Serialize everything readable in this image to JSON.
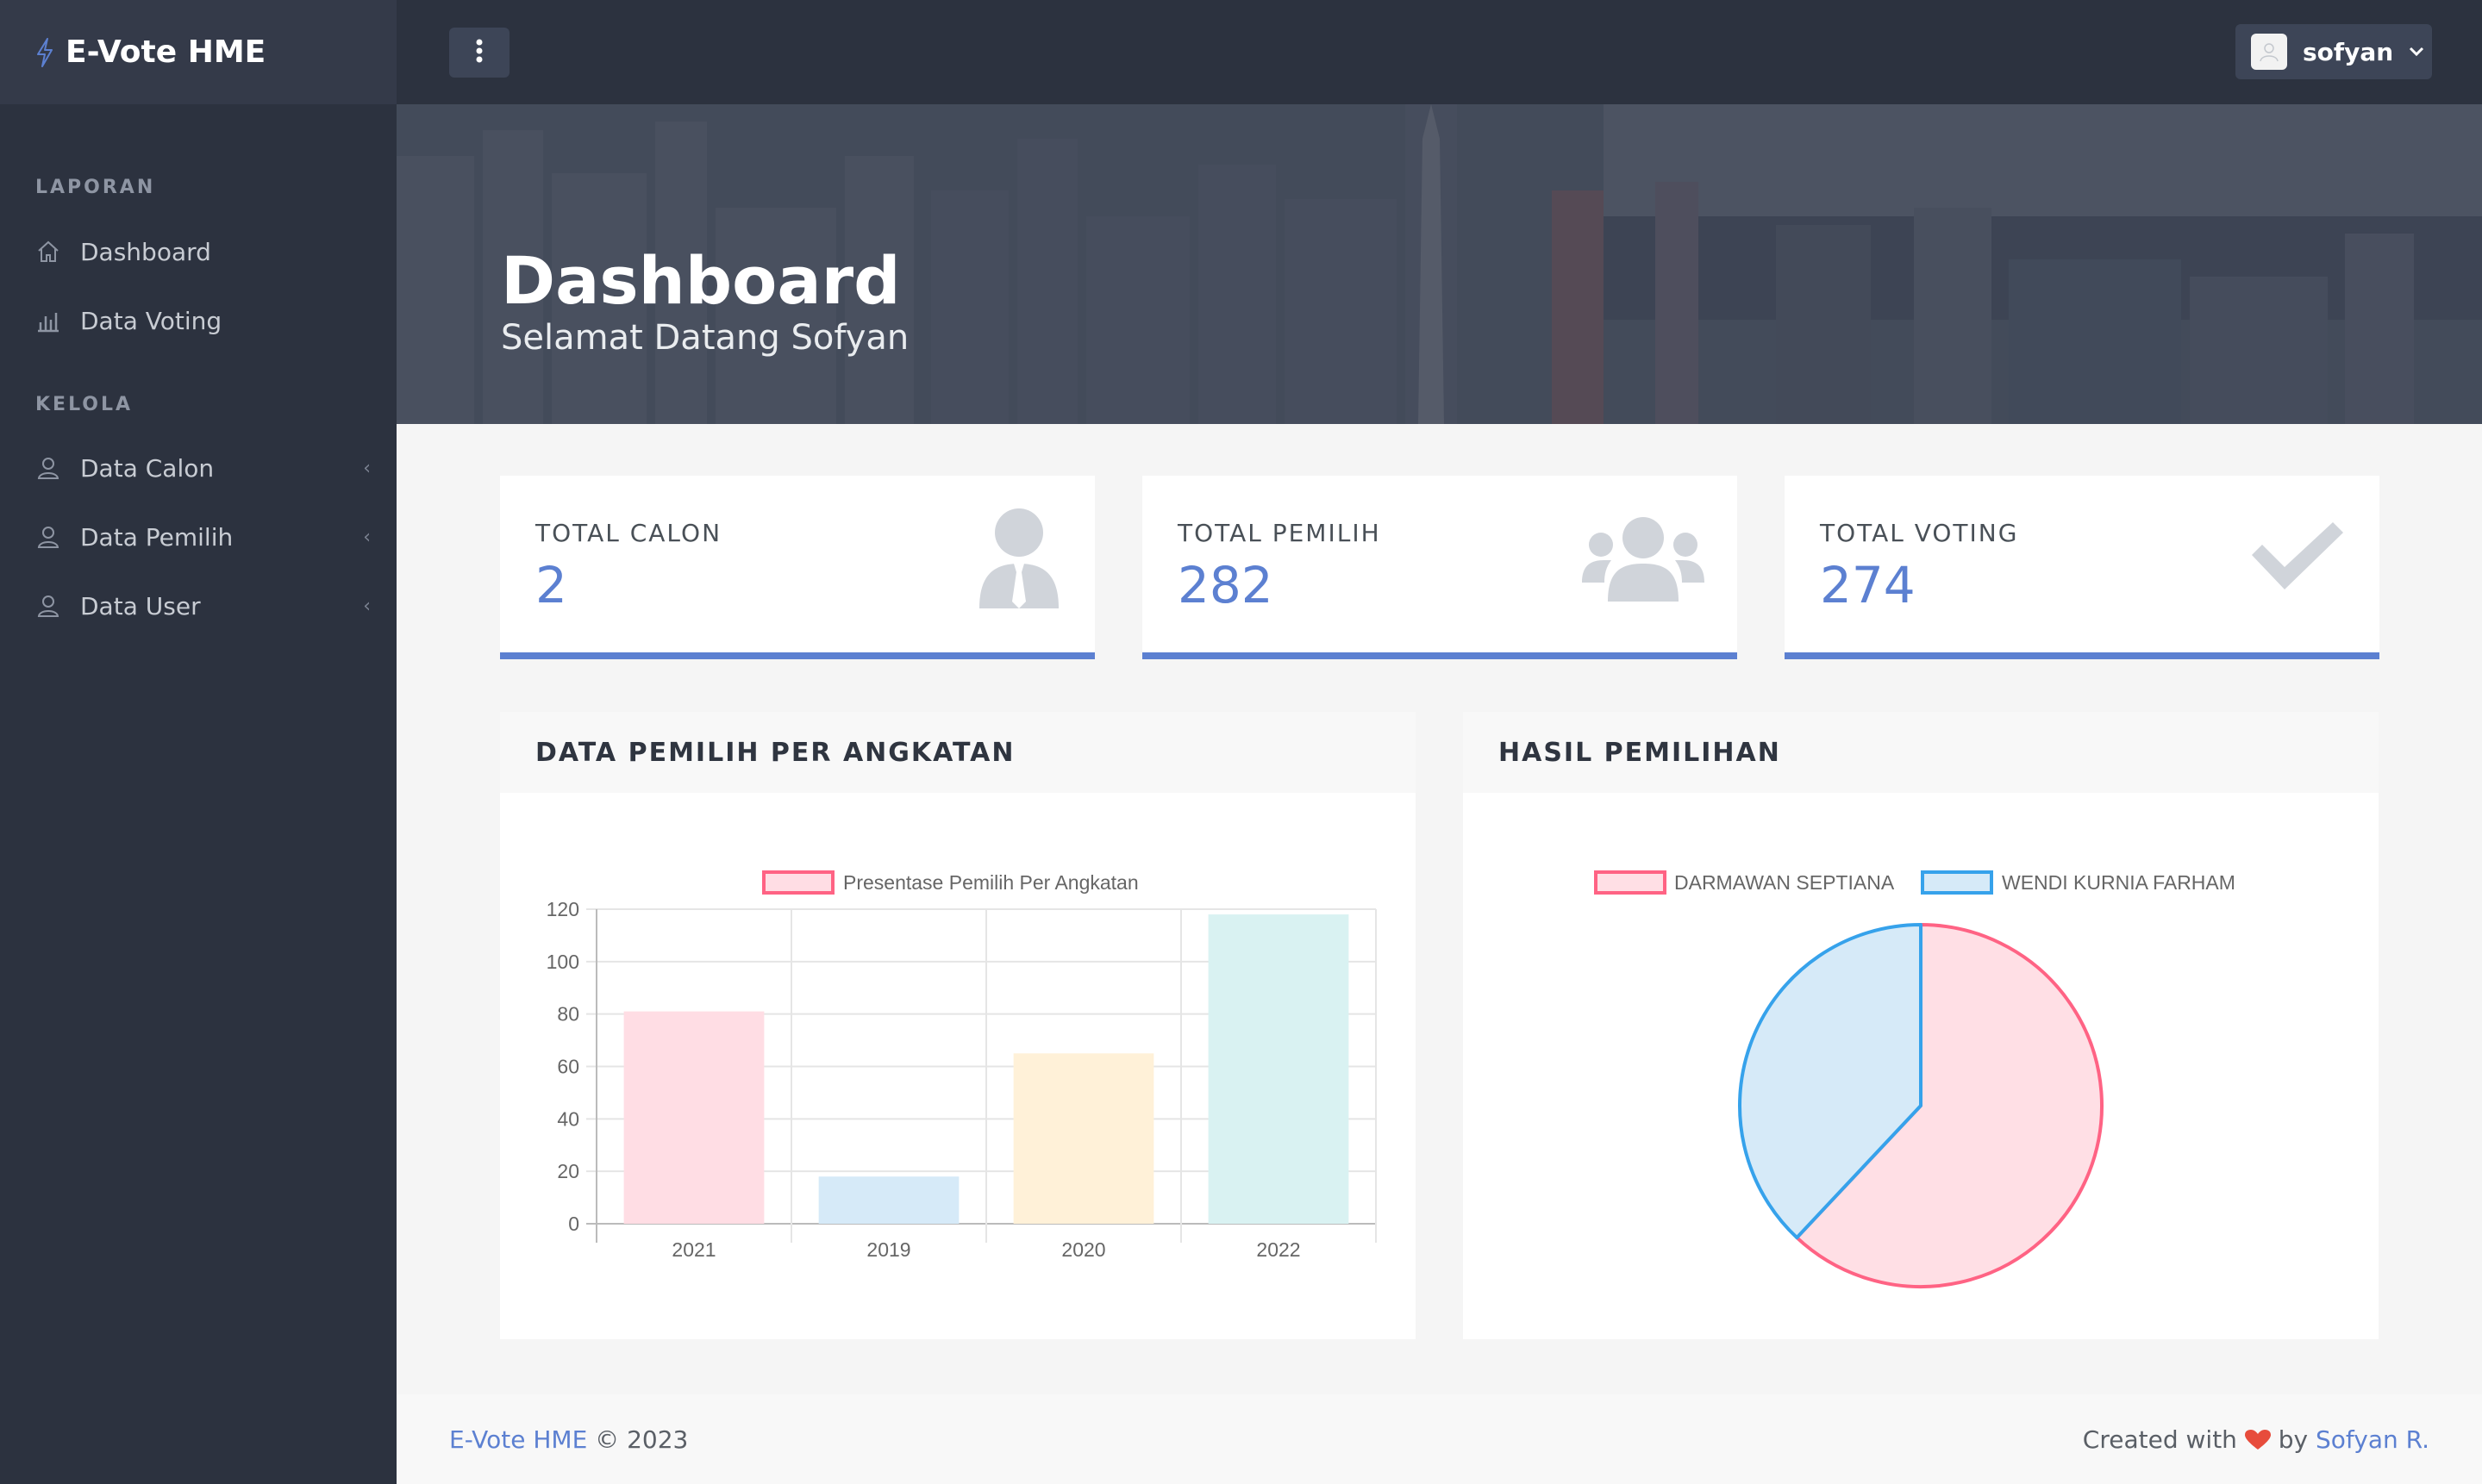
{
  "app": {
    "name": "E-Vote HME",
    "user": "sofyan"
  },
  "sidebar": {
    "sections": [
      {
        "heading": "LAPORAN",
        "items": [
          {
            "label": "Dashboard",
            "icon": "home-icon"
          },
          {
            "label": "Data Voting",
            "icon": "bar-chart-icon"
          }
        ]
      },
      {
        "heading": "KELOLA",
        "items": [
          {
            "label": "Data Calon",
            "icon": "user-icon",
            "chevron": "‹"
          },
          {
            "label": "Data Pemilih",
            "icon": "user-icon",
            "chevron": "‹"
          },
          {
            "label": "Data User",
            "icon": "user-icon",
            "chevron": "‹"
          }
        ]
      }
    ]
  },
  "hero": {
    "title": "Dashboard",
    "subtitle": "Selamat Datang Sofyan"
  },
  "stats": [
    {
      "label": "TOTAL CALON",
      "value": "2",
      "icon": "user-tie-icon"
    },
    {
      "label": "TOTAL PEMILIH",
      "value": "282",
      "icon": "users-icon"
    },
    {
      "label": "TOTAL VOTING",
      "value": "274",
      "icon": "check-icon"
    }
  ],
  "panels": {
    "bar_title": "DATA PEMILIH PER ANGKATAN",
    "pie_title": "HASIL PEMILIHAN"
  },
  "chart_data": [
    {
      "type": "bar",
      "categories": [
        "2021",
        "2019",
        "2020",
        "2022"
      ],
      "series": [
        {
          "name": "Presentase Pemilih Per Angkatan",
          "values": [
            81,
            18,
            65,
            118
          ]
        }
      ],
      "ylim": [
        0,
        120
      ],
      "yticks": [
        0,
        20,
        40,
        60,
        80,
        100,
        120
      ],
      "bar_colors": [
        "#ffdde4",
        "#d6eaf8",
        "#fff1d8",
        "#d9f2f2"
      ],
      "legend_color": "#ff6384",
      "grid": true,
      "legend": "top"
    },
    {
      "type": "pie",
      "labels": [
        "DARMAWAN SEPTIANA",
        "WENDI KURNIA FARHAM"
      ],
      "values": [
        62,
        38
      ],
      "fill_colors": [
        "#ffdfe5",
        "#d6eaf8"
      ],
      "stroke_colors": [
        "#ff6384",
        "#36a2eb"
      ],
      "legend": "top"
    }
  ],
  "footer": {
    "brand": "E-Vote HME",
    "copyright": " © 2023",
    "created": "Created with",
    "by": " by ",
    "author": "Sofyan R.",
    "heart_color": "#e74c3c"
  }
}
